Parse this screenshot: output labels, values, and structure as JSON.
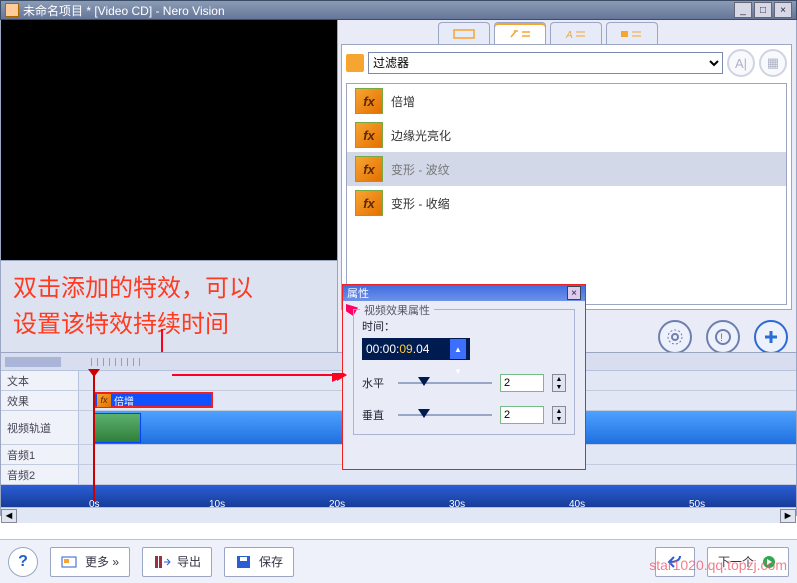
{
  "window": {
    "title": "未命名项目 * [Video CD] - Nero Vision"
  },
  "callout": {
    "line1": "双击添加的特效，可以",
    "line2": "设置该特效持续时间"
  },
  "filters": {
    "dropdown_label": "过滤器",
    "items": [
      {
        "label": "倍增",
        "glyph": "fx"
      },
      {
        "label": "边缘光亮化",
        "glyph": "fx"
      },
      {
        "label": "变形 - 波纹",
        "glyph": "fx",
        "selected": true
      },
      {
        "label": "变形 - 收缩",
        "glyph": "fx"
      }
    ]
  },
  "properties": {
    "caption": "属性",
    "group": "视频效果属性",
    "time_label": "时间：",
    "time_value_prefix": "00:00:",
    "time_value_sec": "09",
    "time_value_suffix": ".04",
    "horiz_label": "水平",
    "horiz_value": "2",
    "vert_label": "垂直",
    "vert_value": "2"
  },
  "timeline": {
    "tracks": {
      "text": "文本",
      "effects": "效果",
      "video": "视频轨道",
      "audio1": "音频1",
      "audio2": "音频2"
    },
    "effect_clip_label": "倍增",
    "ticks": [
      "0s",
      "10s",
      "20s",
      "30s",
      "40s",
      "50s"
    ]
  },
  "commands": {
    "more": "更多 »",
    "export": "导出",
    "save": "保存",
    "next": "下一个"
  },
  "watermark": "star1020.qq.topzj.com"
}
